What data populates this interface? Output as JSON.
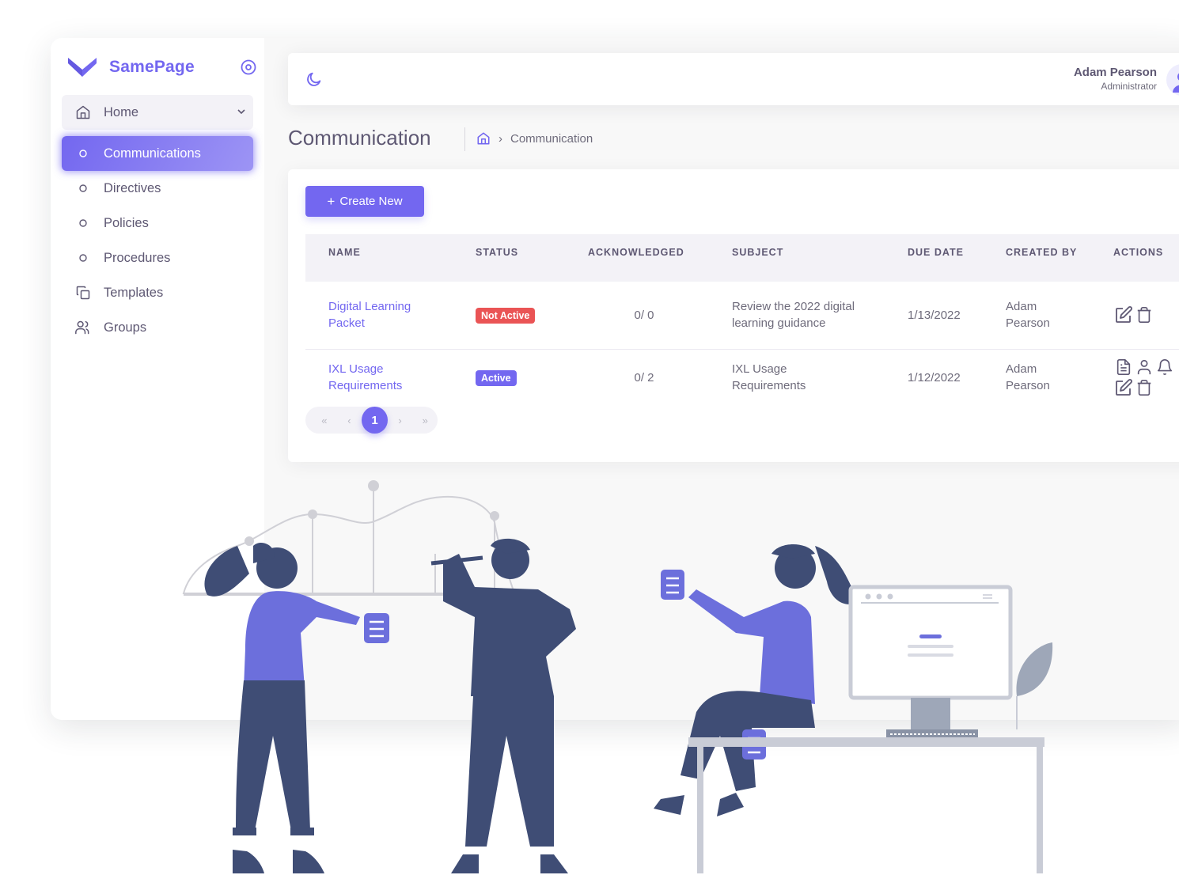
{
  "brand": {
    "name": "SamePage",
    "accent": "#7367f0"
  },
  "sidebar": {
    "items": [
      {
        "label": "Home",
        "icon": "home-icon"
      },
      {
        "label": "Communications",
        "icon": "circle-icon",
        "active": true
      },
      {
        "label": "Directives",
        "icon": "circle-icon"
      },
      {
        "label": "Policies",
        "icon": "circle-icon"
      },
      {
        "label": "Procedures",
        "icon": "circle-icon"
      },
      {
        "label": "Templates",
        "icon": "copy-icon"
      },
      {
        "label": "Groups",
        "icon": "users-icon"
      }
    ]
  },
  "navbar": {
    "user_name": "Adam Pearson",
    "user_role": "Administrator",
    "theme_icon": "moon-icon"
  },
  "page": {
    "title": "Communication",
    "breadcrumb_current": "Communication"
  },
  "toolbar": {
    "create_label": "Create New"
  },
  "table": {
    "columns": [
      "NAME",
      "STATUS",
      "ACKNOWLEDGED",
      "SUBJECT",
      "DUE DATE",
      "CREATED BY",
      "ACTIONS"
    ],
    "rows": [
      {
        "name": "Digital Learning Packet",
        "status": "Not Active",
        "acknowledged": "0/ 0",
        "subject": "Review the 2022 digital learning guidance",
        "due_date": "1/13/2022",
        "created_by": "Adam Pearson",
        "actions": [
          "edit-icon",
          "trash-icon"
        ]
      },
      {
        "name": "IXL Usage Requirements",
        "status": "Active",
        "acknowledged": "0/ 2",
        "subject": "IXL Usage Requirements",
        "due_date": "1/12/2022",
        "created_by": "Adam Pearson",
        "actions": [
          "file-text-icon",
          "user-icon",
          "bell-icon",
          "edit-icon",
          "trash-icon"
        ]
      }
    ]
  },
  "pagination": {
    "first": "«",
    "prev": "‹",
    "current": "1",
    "next": "›",
    "last": "»"
  },
  "colors": {
    "primary": "#7367f0",
    "danger": "#ea5455",
    "figure_dark": "#3f4d75",
    "figure_purple": "#6c6fdc"
  }
}
